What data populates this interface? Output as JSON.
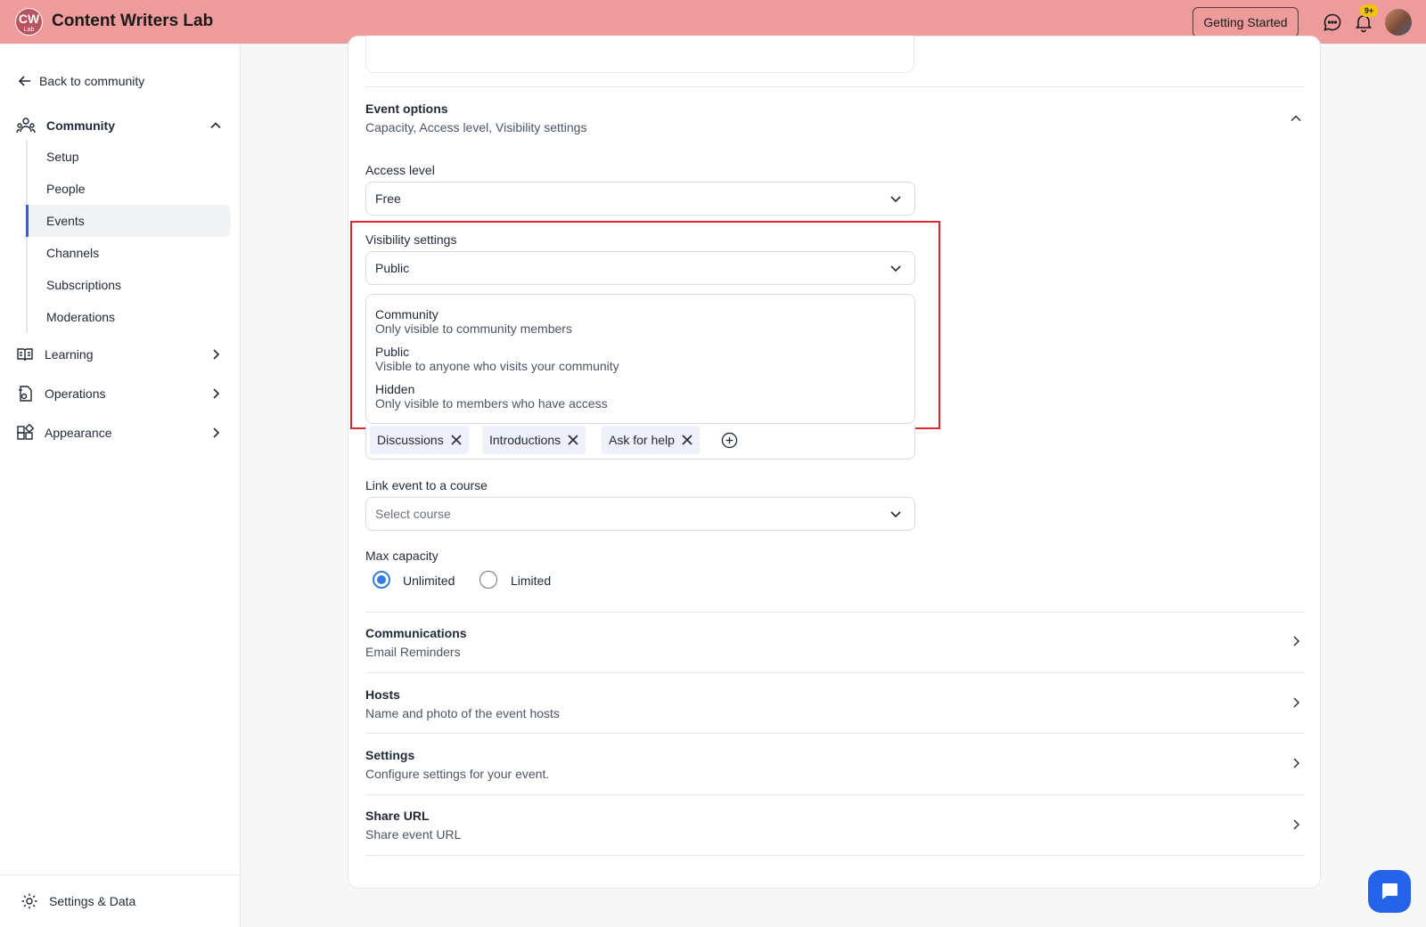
{
  "header": {
    "logo_text": "CW",
    "logo_sub": "Lab",
    "app_name": "Content Writers Lab",
    "getting_started_label": "Getting Started",
    "notification_count": "9+"
  },
  "sidebar": {
    "back_label": "Back to community",
    "groups": [
      {
        "label": "Community",
        "icon": "community-icon",
        "expanded": true
      },
      {
        "label": "Learning",
        "icon": "book-icon",
        "expanded": false
      },
      {
        "label": "Operations",
        "icon": "operations-icon",
        "expanded": false
      },
      {
        "label": "Appearance",
        "icon": "appearance-icon",
        "expanded": false
      }
    ],
    "community_items": [
      "Setup",
      "People",
      "Events",
      "Channels",
      "Subscriptions",
      "Moderations"
    ],
    "active_item": "Events",
    "footer_label": "Settings & Data"
  },
  "event_options": {
    "title": "Event options",
    "subtitle": "Capacity, Access level, Visibility settings",
    "access_level": {
      "label": "Access level",
      "value": "Free"
    },
    "visibility": {
      "label": "Visibility settings",
      "value": "Public",
      "options": [
        {
          "title": "Community",
          "desc": "Only visible to community members"
        },
        {
          "title": "Public",
          "desc": "Visible to anyone who visits your community"
        },
        {
          "title": "Hidden",
          "desc": "Only visible to members who have access"
        }
      ]
    },
    "channels": [
      "Discussions",
      "Introductions",
      "Ask for help"
    ],
    "course": {
      "label": "Link event to a course",
      "placeholder": "Select course"
    },
    "capacity": {
      "label": "Max capacity",
      "options": [
        "Unlimited",
        "Limited"
      ],
      "selected": "Unlimited"
    }
  },
  "sections": [
    {
      "title": "Communications",
      "subtitle": "Email Reminders"
    },
    {
      "title": "Hosts",
      "subtitle": "Name and photo of the event hosts"
    },
    {
      "title": "Settings",
      "subtitle": "Configure settings for your event."
    },
    {
      "title": "Share URL",
      "subtitle": "Share event URL"
    }
  ],
  "colors": {
    "header_bg": "#ee9b9b",
    "accent": "#2f5bea",
    "highlight": "#e0262a",
    "radio": "#2f7de1"
  }
}
